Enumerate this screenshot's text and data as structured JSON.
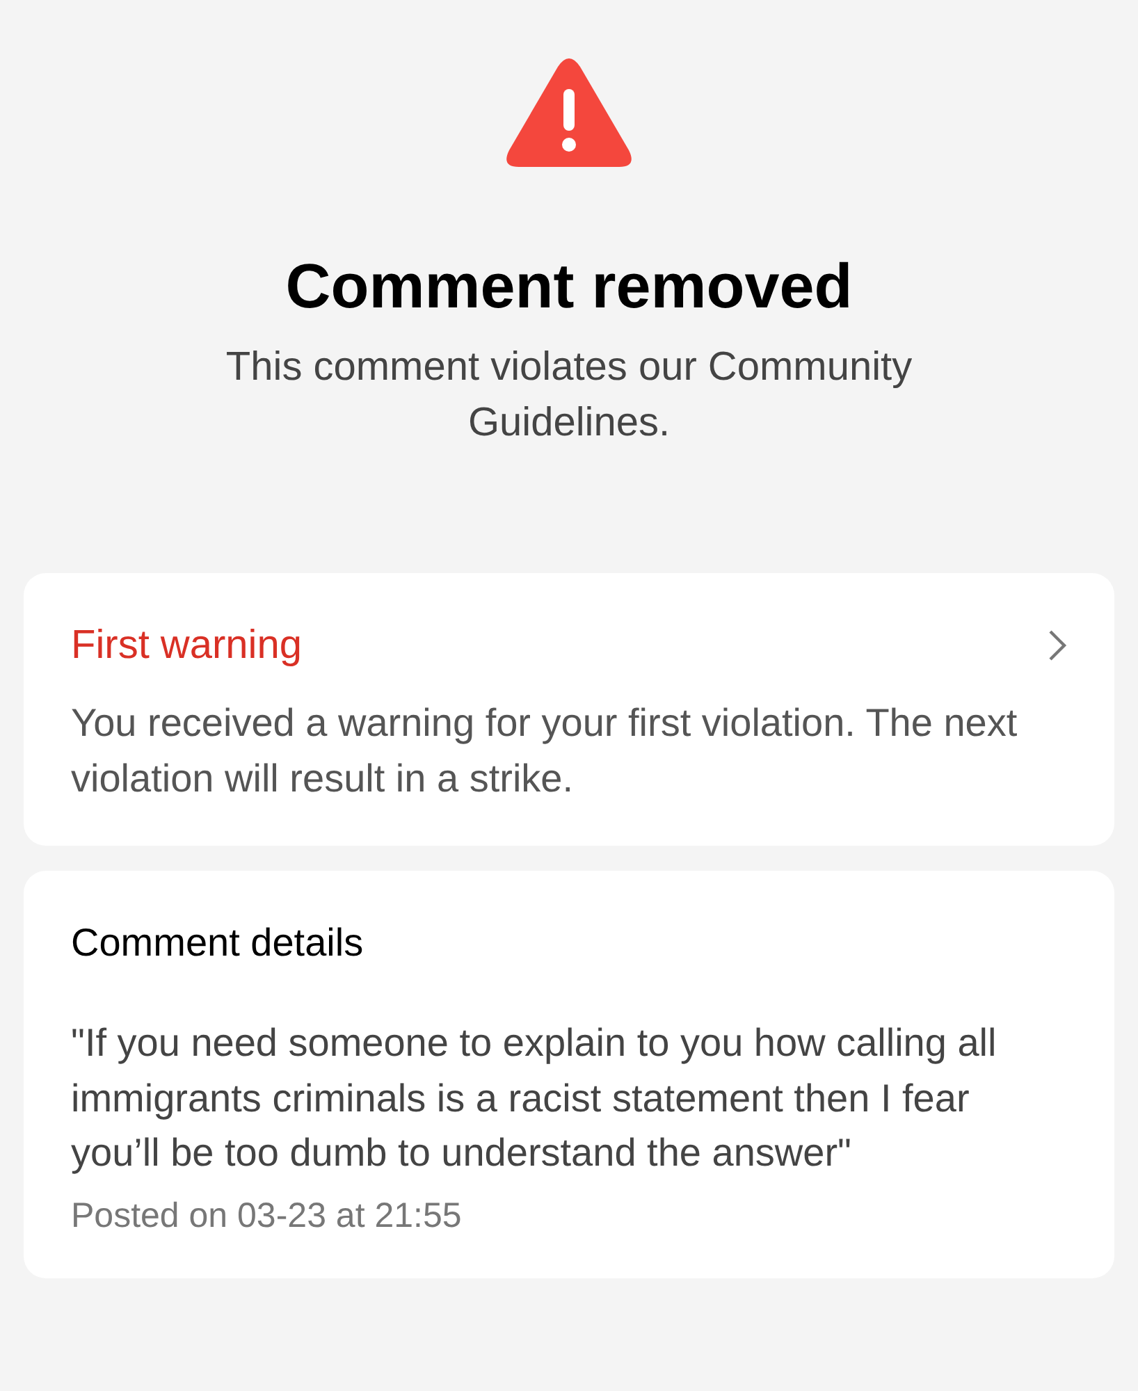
{
  "header": {
    "title": "Comment removed",
    "subtitle": "This comment violates our Community Guidelines."
  },
  "warning_card": {
    "title": "First warning",
    "body": "You received a warning for your first violation. The next violation will result in a strike."
  },
  "details_card": {
    "title": "Comment details",
    "quote": "\"If you need someone to explain to you how calling all immigrants criminals is a racist statement then I fear you’ll be too dumb to understand the answer\"",
    "posted": "Posted on 03-23 at 21:55"
  }
}
